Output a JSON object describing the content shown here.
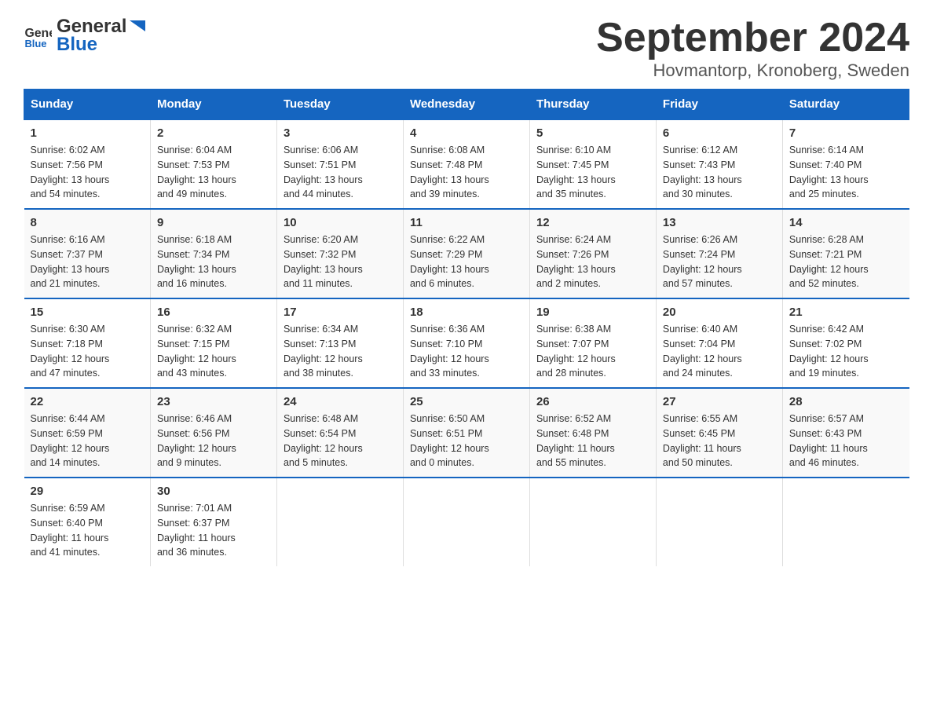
{
  "header": {
    "logo": {
      "general": "General",
      "blue": "Blue"
    },
    "title": "September 2024",
    "subtitle": "Hovmantorp, Kronoberg, Sweden"
  },
  "weekdays": [
    "Sunday",
    "Monday",
    "Tuesday",
    "Wednesday",
    "Thursday",
    "Friday",
    "Saturday"
  ],
  "weeks": [
    [
      {
        "day": "1",
        "sunrise": "6:02 AM",
        "sunset": "7:56 PM",
        "daylight": "13 hours and 54 minutes."
      },
      {
        "day": "2",
        "sunrise": "6:04 AM",
        "sunset": "7:53 PM",
        "daylight": "13 hours and 49 minutes."
      },
      {
        "day": "3",
        "sunrise": "6:06 AM",
        "sunset": "7:51 PM",
        "daylight": "13 hours and 44 minutes."
      },
      {
        "day": "4",
        "sunrise": "6:08 AM",
        "sunset": "7:48 PM",
        "daylight": "13 hours and 39 minutes."
      },
      {
        "day": "5",
        "sunrise": "6:10 AM",
        "sunset": "7:45 PM",
        "daylight": "13 hours and 35 minutes."
      },
      {
        "day": "6",
        "sunrise": "6:12 AM",
        "sunset": "7:43 PM",
        "daylight": "13 hours and 30 minutes."
      },
      {
        "day": "7",
        "sunrise": "6:14 AM",
        "sunset": "7:40 PM",
        "daylight": "13 hours and 25 minutes."
      }
    ],
    [
      {
        "day": "8",
        "sunrise": "6:16 AM",
        "sunset": "7:37 PM",
        "daylight": "13 hours and 21 minutes."
      },
      {
        "day": "9",
        "sunrise": "6:18 AM",
        "sunset": "7:34 PM",
        "daylight": "13 hours and 16 minutes."
      },
      {
        "day": "10",
        "sunrise": "6:20 AM",
        "sunset": "7:32 PM",
        "daylight": "13 hours and 11 minutes."
      },
      {
        "day": "11",
        "sunrise": "6:22 AM",
        "sunset": "7:29 PM",
        "daylight": "13 hours and 6 minutes."
      },
      {
        "day": "12",
        "sunrise": "6:24 AM",
        "sunset": "7:26 PM",
        "daylight": "13 hours and 2 minutes."
      },
      {
        "day": "13",
        "sunrise": "6:26 AM",
        "sunset": "7:24 PM",
        "daylight": "12 hours and 57 minutes."
      },
      {
        "day": "14",
        "sunrise": "6:28 AM",
        "sunset": "7:21 PM",
        "daylight": "12 hours and 52 minutes."
      }
    ],
    [
      {
        "day": "15",
        "sunrise": "6:30 AM",
        "sunset": "7:18 PM",
        "daylight": "12 hours and 47 minutes."
      },
      {
        "day": "16",
        "sunrise": "6:32 AM",
        "sunset": "7:15 PM",
        "daylight": "12 hours and 43 minutes."
      },
      {
        "day": "17",
        "sunrise": "6:34 AM",
        "sunset": "7:13 PM",
        "daylight": "12 hours and 38 minutes."
      },
      {
        "day": "18",
        "sunrise": "6:36 AM",
        "sunset": "7:10 PM",
        "daylight": "12 hours and 33 minutes."
      },
      {
        "day": "19",
        "sunrise": "6:38 AM",
        "sunset": "7:07 PM",
        "daylight": "12 hours and 28 minutes."
      },
      {
        "day": "20",
        "sunrise": "6:40 AM",
        "sunset": "7:04 PM",
        "daylight": "12 hours and 24 minutes."
      },
      {
        "day": "21",
        "sunrise": "6:42 AM",
        "sunset": "7:02 PM",
        "daylight": "12 hours and 19 minutes."
      }
    ],
    [
      {
        "day": "22",
        "sunrise": "6:44 AM",
        "sunset": "6:59 PM",
        "daylight": "12 hours and 14 minutes."
      },
      {
        "day": "23",
        "sunrise": "6:46 AM",
        "sunset": "6:56 PM",
        "daylight": "12 hours and 9 minutes."
      },
      {
        "day": "24",
        "sunrise": "6:48 AM",
        "sunset": "6:54 PM",
        "daylight": "12 hours and 5 minutes."
      },
      {
        "day": "25",
        "sunrise": "6:50 AM",
        "sunset": "6:51 PM",
        "daylight": "12 hours and 0 minutes."
      },
      {
        "day": "26",
        "sunrise": "6:52 AM",
        "sunset": "6:48 PM",
        "daylight": "11 hours and 55 minutes."
      },
      {
        "day": "27",
        "sunrise": "6:55 AM",
        "sunset": "6:45 PM",
        "daylight": "11 hours and 50 minutes."
      },
      {
        "day": "28",
        "sunrise": "6:57 AM",
        "sunset": "6:43 PM",
        "daylight": "11 hours and 46 minutes."
      }
    ],
    [
      {
        "day": "29",
        "sunrise": "6:59 AM",
        "sunset": "6:40 PM",
        "daylight": "11 hours and 41 minutes."
      },
      {
        "day": "30",
        "sunrise": "7:01 AM",
        "sunset": "6:37 PM",
        "daylight": "11 hours and 36 minutes."
      },
      null,
      null,
      null,
      null,
      null
    ]
  ]
}
